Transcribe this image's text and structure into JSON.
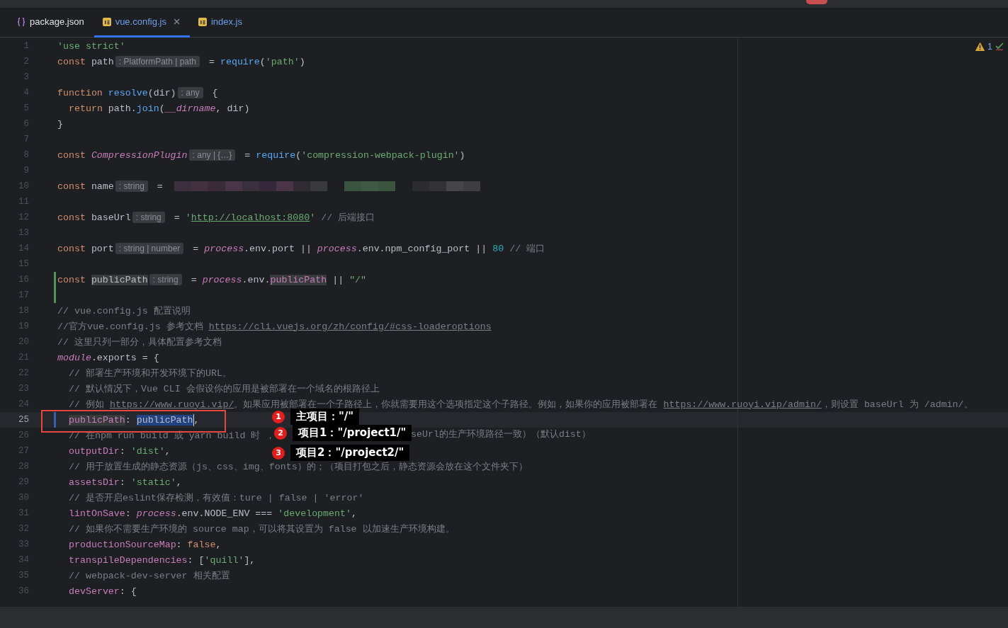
{
  "tabs": [
    {
      "label": "package.json",
      "kind": "json",
      "selected": false,
      "modified": false,
      "closable": false
    },
    {
      "label": "vue.config.js",
      "kind": "js",
      "selected": true,
      "modified": true,
      "closable": true
    },
    {
      "label": "index.js",
      "kind": "js",
      "selected": false,
      "modified": true,
      "closable": false
    }
  ],
  "inspections": {
    "warnings": "1"
  },
  "lines": [
    {
      "number": "1",
      "tokens": [
        {
          "kind": "str",
          "text": "'use strict'"
        }
      ]
    },
    {
      "number": "2",
      "tokens": [
        {
          "kind": "kw",
          "text": "const "
        },
        {
          "kind": "plain",
          "text": "path"
        },
        {
          "kind": "hint",
          "text": ": PlatformPath | path"
        },
        {
          "kind": "plain",
          "text": " = "
        },
        {
          "kind": "fn",
          "text": "require"
        },
        {
          "kind": "plain",
          "text": "("
        },
        {
          "kind": "str",
          "text": "'path'"
        },
        {
          "kind": "plain",
          "text": ")"
        }
      ]
    },
    {
      "number": "3"
    },
    {
      "number": "4",
      "tokens": [
        {
          "kind": "kw",
          "text": "function "
        },
        {
          "kind": "fn",
          "text": "resolve"
        },
        {
          "kind": "plain",
          "text": "(dir)"
        },
        {
          "kind": "hint",
          "text": ": any"
        },
        {
          "kind": "plain",
          "text": " {"
        }
      ]
    },
    {
      "number": "5",
      "indented": true,
      "tokens": [
        {
          "kind": "kw",
          "text": "return "
        },
        {
          "kind": "plain",
          "text": "path."
        },
        {
          "kind": "fn",
          "text": "join"
        },
        {
          "kind": "plain",
          "text": "("
        },
        {
          "kind": "glob",
          "text": "__dirname"
        },
        {
          "kind": "plain",
          "text": ", dir)"
        }
      ]
    },
    {
      "number": "6",
      "tokens": [
        {
          "kind": "plain",
          "text": "}"
        }
      ]
    },
    {
      "number": "7"
    },
    {
      "number": "8",
      "tokens": [
        {
          "kind": "kw",
          "text": "const "
        },
        {
          "kind": "glob",
          "text": "CompressionPlugin"
        },
        {
          "kind": "hint",
          "text": ": any | {…}"
        },
        {
          "kind": "plain",
          "text": " = "
        },
        {
          "kind": "fn",
          "text": "require"
        },
        {
          "kind": "plain",
          "text": "("
        },
        {
          "kind": "str",
          "text": "'compression-webpack-plugin'"
        },
        {
          "kind": "plain",
          "text": ")"
        }
      ]
    },
    {
      "number": "9"
    },
    {
      "number": "10",
      "tokens": [
        {
          "kind": "kw",
          "text": "const "
        },
        {
          "kind": "plain",
          "text": "name"
        },
        {
          "kind": "hint",
          "text": ": string"
        },
        {
          "kind": "plain",
          "text": " = "
        },
        {
          "kind": "redacted"
        }
      ]
    },
    {
      "number": "11"
    },
    {
      "number": "12",
      "tokens": [
        {
          "kind": "kw",
          "text": "const "
        },
        {
          "kind": "plain",
          "text": "baseUrl"
        },
        {
          "kind": "hint",
          "text": ": string"
        },
        {
          "kind": "plain",
          "text": " = "
        },
        {
          "kind": "str",
          "text": "'"
        },
        {
          "kind": "strlink",
          "text": "http://localhost:8080"
        },
        {
          "kind": "str",
          "text": "'"
        },
        {
          "kind": "com",
          "text": " // 后端接口"
        }
      ]
    },
    {
      "number": "13"
    },
    {
      "number": "14",
      "tokens": [
        {
          "kind": "kw",
          "text": "const "
        },
        {
          "kind": "plain",
          "text": "port"
        },
        {
          "kind": "hint",
          "text": ": string | number"
        },
        {
          "kind": "plain",
          "text": " = "
        },
        {
          "kind": "glob",
          "text": "process"
        },
        {
          "kind": "plain",
          "text": ".env.port || "
        },
        {
          "kind": "glob",
          "text": "process"
        },
        {
          "kind": "plain",
          "text": ".env.npm_config_port || "
        },
        {
          "kind": "num",
          "text": "80"
        },
        {
          "kind": "com",
          "text": " // 端口"
        }
      ]
    },
    {
      "number": "15"
    },
    {
      "number": "16",
      "added": true,
      "tokens": [
        {
          "kind": "kw",
          "text": "const "
        },
        {
          "kind": "plain",
          "text": "publicPath",
          "usage": true
        },
        {
          "kind": "hint",
          "text": ": string"
        },
        {
          "kind": "plain",
          "text": " = "
        },
        {
          "kind": "glob",
          "text": "process"
        },
        {
          "kind": "plain",
          "text": ".env."
        },
        {
          "kind": "prop",
          "text": "publicPath",
          "usage": true
        },
        {
          "kind": "plain",
          "text": " || "
        },
        {
          "kind": "str",
          "text": "\"/\""
        }
      ]
    },
    {
      "number": "17",
      "added": true
    },
    {
      "number": "18",
      "tokens": [
        {
          "kind": "com",
          "text": "// vue.config.js 配置说明"
        }
      ]
    },
    {
      "number": "19",
      "tokens": [
        {
          "kind": "com",
          "text": "//官方vue.config.js 参考文档 "
        },
        {
          "kind": "link",
          "text": "https://cli.vuejs.org/zh/config/#css-loaderoptions"
        }
      ]
    },
    {
      "number": "20",
      "tokens": [
        {
          "kind": "com",
          "text": "// 这里只列一部分，具体配置参考文档"
        }
      ]
    },
    {
      "number": "21",
      "tokens": [
        {
          "kind": "glob",
          "text": "module"
        },
        {
          "kind": "plain",
          "text": ".exports = {"
        }
      ]
    },
    {
      "number": "22",
      "indented": true,
      "tokens": [
        {
          "kind": "com",
          "text": "// 部署生产环境和开发环境下的URL。"
        }
      ]
    },
    {
      "number": "23",
      "indented": true,
      "tokens": [
        {
          "kind": "com",
          "text": "// 默认情况下，Vue CLI 会假设你的应用是被部署在一个域名的根路径上"
        }
      ]
    },
    {
      "number": "24",
      "indented": true,
      "tokens": [
        {
          "kind": "com",
          "text": "// 例如 "
        },
        {
          "kind": "link",
          "text": "https://www.ruoyi.vip/"
        },
        {
          "kind": "com",
          "text": "。如果应用被部署在一个子路径上，你就需要用这个选项指定这个子路径。例如，如果你的应用被部署在 "
        },
        {
          "kind": "link",
          "text": "https://www.ruoyi.vip/admin/"
        },
        {
          "kind": "com",
          "text": "，则设置 baseUrl 为 /admin/。"
        }
      ]
    },
    {
      "number": "25",
      "current": true,
      "modified": true,
      "indented": true,
      "tokens": [
        {
          "kind": "prop",
          "text": "publicPath",
          "usage": true
        },
        {
          "kind": "plain",
          "text": ": "
        },
        {
          "kind": "plain",
          "text": "publicPath",
          "selected": true
        },
        {
          "kind": "plain",
          "text": ","
        }
      ]
    },
    {
      "number": "26",
      "indented": true,
      "tokens": [
        {
          "kind": "com",
          "text": "// 在npm run build 或 yarn build 时 ，"
        }
      ],
      "tokens_after_callouts": [
        {
          "kind": "com",
          "text": "seUrl的生产环境路径一致）（默认dist）"
        }
      ]
    },
    {
      "number": "27",
      "indented": true,
      "tokens": [
        {
          "kind": "prop",
          "text": "outputDir"
        },
        {
          "kind": "plain",
          "text": ": "
        },
        {
          "kind": "str",
          "text": "'dist'"
        },
        {
          "kind": "plain",
          "text": ","
        }
      ]
    },
    {
      "number": "28",
      "indented": true,
      "tokens": [
        {
          "kind": "com",
          "text": "// 用于放置生成的静态资源（js、css、img、fonts）的；（项目打包之后，静态资源会放在这个文件夹下）"
        }
      ]
    },
    {
      "number": "29",
      "indented": true,
      "tokens": [
        {
          "kind": "prop",
          "text": "assetsDir"
        },
        {
          "kind": "plain",
          "text": ": "
        },
        {
          "kind": "str",
          "text": "'static'"
        },
        {
          "kind": "plain",
          "text": ","
        }
      ]
    },
    {
      "number": "30",
      "indented": true,
      "tokens": [
        {
          "kind": "com",
          "text": "// 是否开启eslint保存检测，有效值：ture | false | 'error'"
        }
      ]
    },
    {
      "number": "31",
      "indented": true,
      "tokens": [
        {
          "kind": "prop",
          "text": "lintOnSave"
        },
        {
          "kind": "plain",
          "text": ": "
        },
        {
          "kind": "glob",
          "text": "process"
        },
        {
          "kind": "plain",
          "text": ".env.NODE_ENV === "
        },
        {
          "kind": "str",
          "text": "'development'"
        },
        {
          "kind": "plain",
          "text": ","
        }
      ]
    },
    {
      "number": "32",
      "indented": true,
      "tokens": [
        {
          "kind": "com",
          "text": "// 如果你不需要生产环境的 source map，可以将其设置为 false 以加速生产环境构建。"
        }
      ]
    },
    {
      "number": "33",
      "indented": true,
      "tokens": [
        {
          "kind": "prop",
          "text": "productionSourceMap"
        },
        {
          "kind": "plain",
          "text": ": "
        },
        {
          "kind": "kw",
          "text": "false"
        },
        {
          "kind": "plain",
          "text": ","
        }
      ]
    },
    {
      "number": "34",
      "indented": true,
      "tokens": [
        {
          "kind": "prop",
          "text": "transpileDependencies"
        },
        {
          "kind": "plain",
          "text": ": ["
        },
        {
          "kind": "str",
          "text": "'quill'"
        },
        {
          "kind": "plain",
          "text": "],"
        }
      ]
    },
    {
      "number": "35",
      "indented": true,
      "tokens": [
        {
          "kind": "com",
          "text": "// webpack-dev-server 相关配置"
        }
      ]
    },
    {
      "number": "36",
      "indented": true,
      "tokens": [
        {
          "kind": "prop",
          "text": "devServer"
        },
        {
          "kind": "plain",
          "text": ": {"
        }
      ]
    }
  ],
  "annotation": {
    "callouts": [
      {
        "badge": "1",
        "text": "主项目：\"/\""
      },
      {
        "badge": "2",
        "text": "项目1：\"/project1/\""
      },
      {
        "badge": "3",
        "text": "项目2：\"/project2/\""
      }
    ]
  }
}
